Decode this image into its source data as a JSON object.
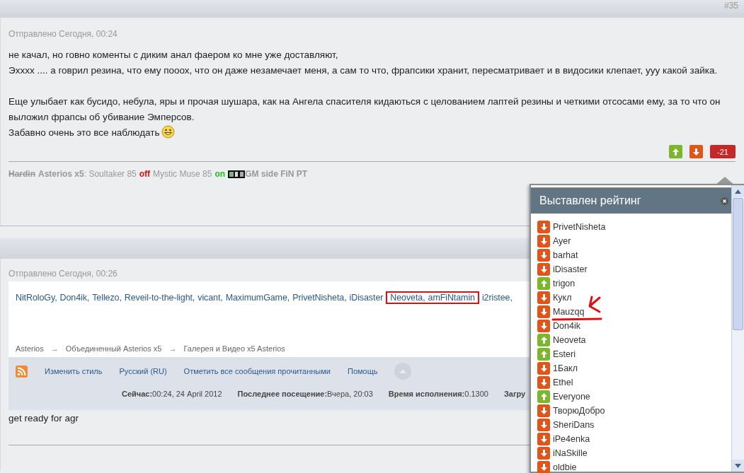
{
  "post_number": "#35",
  "post1": {
    "meta": "Отправлено Сегодня, 00:24",
    "blocks": [
      [
        "не качал, но говно коменты с диким анал фаером ко мне уже доставляют,",
        "Эхххх .... а говрил резина, что ему пооох, что он даже незамечает меня, а сам то что, фрапсики хранит, пересматривает и в видосики клепает, ууу какой зайка."
      ],
      [
        "Еще улыбает как бусидо, небула, яры и прочая шушара, как на Ангела спасителя кидаються с целованием лаптей резины и четкими отсосами ему, за то что он выложил фрапсы об убивание Эмперсов.",
        "Забавно очень это все наблюдать"
      ]
    ],
    "score": "-21",
    "signature": [
      {
        "kind": "strike",
        "text": "Hardin"
      },
      {
        "kind": "bold",
        "text": "Asterios x5"
      },
      {
        "kind": "plain",
        "text": ": Soultaker 85"
      },
      {
        "kind": "off",
        "text": "off"
      },
      {
        "kind": "plain",
        "text": "Mystic Muse 85"
      },
      {
        "kind": "on",
        "text": "on"
      },
      {
        "kind": "emblem"
      },
      {
        "kind": "bold",
        "text": "GM side FiN PT"
      }
    ]
  },
  "popup": {
    "title": "Выставлен рейтинг",
    "voters": [
      {
        "name": "PrivetNisheta",
        "kind": "down"
      },
      {
        "name": "Ayer",
        "kind": "down"
      },
      {
        "name": "barhat",
        "kind": "down"
      },
      {
        "name": "iDisaster",
        "kind": "down"
      },
      {
        "name": "trigon",
        "kind": "up"
      },
      {
        "name": "Кукл",
        "kind": "down"
      },
      {
        "name": "Mauzqq",
        "kind": "down"
      },
      {
        "name": "Don4ik",
        "kind": "down"
      },
      {
        "name": "Neoveta",
        "kind": "up"
      },
      {
        "name": "Esteri",
        "kind": "up"
      },
      {
        "name": "1Бакл",
        "kind": "down"
      },
      {
        "name": "Ethel",
        "kind": "down"
      },
      {
        "name": "Everyone",
        "kind": "up"
      },
      {
        "name": "ТворюДобро",
        "kind": "down"
      },
      {
        "name": "SheriDans",
        "kind": "down"
      },
      {
        "name": "iPe4enka",
        "kind": "down"
      },
      {
        "name": "iNaSkille",
        "kind": "down"
      },
      {
        "name": "oldbie",
        "kind": "down"
      }
    ]
  },
  "post2": {
    "meta": "Отправлено Сегодня, 00:26",
    "embedded": {
      "users": [
        {
          "name": "NitRoloGy,",
          "highlighted": false
        },
        {
          "name": "Don4ik,",
          "highlighted": false
        },
        {
          "name": "Tellezo,",
          "highlighted": false
        },
        {
          "name": "Reveil-to-the-light,",
          "highlighted": false
        },
        {
          "name": "vicant,",
          "highlighted": false
        },
        {
          "name": "MaximumGame,",
          "highlighted": false
        },
        {
          "name": "PrivetNisheta,",
          "highlighted": false
        },
        {
          "name": "iDisaster",
          "highlighted": false
        },
        {
          "name": "Neoveta,",
          "highlighted": true
        },
        {
          "name": "amFiNtamin",
          "highlighted": true
        },
        {
          "name": "i2ristee,",
          "highlighted": false
        }
      ],
      "breadcrumbs": [
        "Asterios",
        "Объединенный Asterios x5",
        "Галерея и Видео x5 Asterios"
      ],
      "separator": "→",
      "footer_links": [
        "Изменить стиль",
        "Русский (RU)",
        "Отметить все сообщения прочитанными",
        "Помощь"
      ],
      "stats": [
        {
          "label": "Сейчас:",
          "value": "00:24, 24 April 2012"
        },
        {
          "label": "Последнее посещение:",
          "value": "Вчера, 20:03"
        },
        {
          "label": "Время исполнения:",
          "value": "0.1300"
        },
        {
          "label": "Загру"
        }
      ]
    },
    "text": "get ready for agr"
  }
}
